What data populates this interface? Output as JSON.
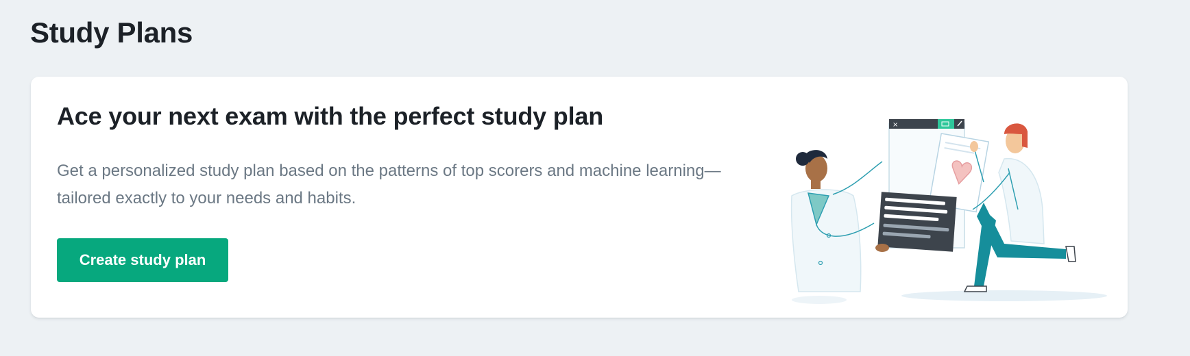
{
  "page": {
    "title": "Study Plans"
  },
  "promo": {
    "heading": "Ace your next exam with the perfect study plan",
    "description": "Get a personalized study plan based on the patterns of top scorers and machine learning—tailored exactly to your needs and habits.",
    "cta_label": "Create study plan",
    "illustration_icon": "doctors-reviewing-heart-document-illustration"
  },
  "colors": {
    "background": "#edf1f4",
    "card": "#ffffff",
    "heading": "#1c2127",
    "body_text": "#6b7884",
    "accent": "#07a87e",
    "teal_outline": "#2e9fb1"
  }
}
